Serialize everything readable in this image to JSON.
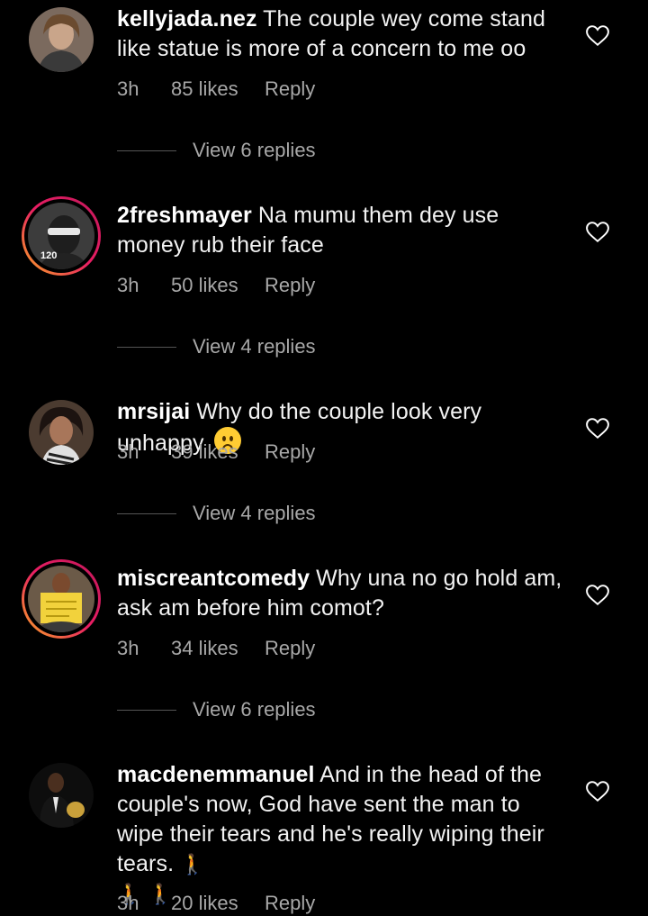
{
  "comments": [
    {
      "username": "kellyjada.nez",
      "text": "The couple wey come stand like statue is more of a concern to me oo",
      "time": "3h",
      "likes": "85 likes",
      "reply": "Reply",
      "view_replies": "View 6 replies",
      "avatar_color": "#8a6f5a"
    },
    {
      "username": "2freshmayer",
      "text": "Na mumu them dey use money rub their face",
      "time": "3h",
      "likes": "50 likes",
      "reply": "Reply",
      "view_replies": "View 4 replies",
      "avatar_color": "#2b2b2b",
      "avatar_badge": "120"
    },
    {
      "username": "mrsijai",
      "text": "Why do the couple look very unhappy",
      "time": "3h",
      "likes": "39 likes",
      "reply": "Reply",
      "view_replies": "View 4 replies",
      "avatar_color": "#5b4636",
      "emoji": "frowning-face-emoji"
    },
    {
      "username": "miscreantcomedy",
      "text": "Why una no go hold am, ask am before him comot?",
      "time": "3h",
      "likes": "34 likes",
      "reply": "Reply",
      "view_replies": "View 6 replies",
      "avatar_color": "#e8c84a"
    },
    {
      "username": "macdenemmanuel",
      "text": "And in the head of the couple's now, God have sent the man to wipe their tears and he's really wiping their tears.",
      "time": "3h",
      "likes": "20 likes",
      "reply": "Reply",
      "avatar_color": "#1a1a1a",
      "emoji": "person-walking-emoji"
    }
  ],
  "colors": {
    "background": "#000000",
    "meta_text": "#a8a8a8",
    "story_ring_start": "#f9a825",
    "story_ring_end": "#c2185b"
  }
}
